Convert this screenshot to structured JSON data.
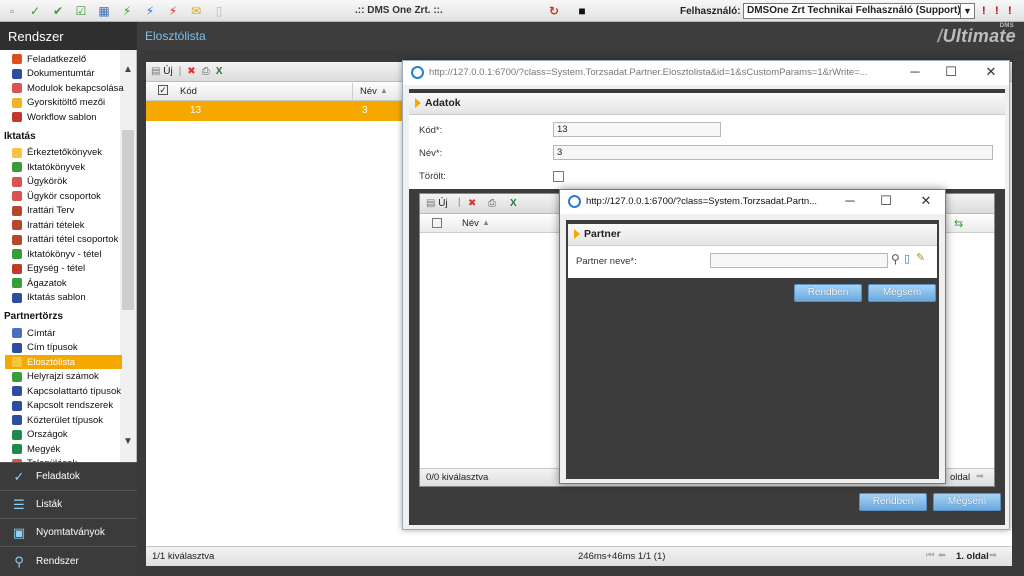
{
  "topbar": {
    "title": ".:: DMS One Zrt. ::.",
    "user_label": "Felhasználó:",
    "user_value": "DMSOne Zrt Technikai Felhasználó (Support)"
  },
  "app": {
    "left_title": "Rendszer",
    "main_title": "Elosztólista",
    "brand_small": "DMS",
    "brand": "Ultimate"
  },
  "nav": {
    "items_top": [
      {
        "label": "Feladatkezelő",
        "color": "#e04e1b"
      },
      {
        "label": "Dokumentumtár",
        "color": "#2b4f9e"
      },
      {
        "label": "Modulok bekapcsolása",
        "color": "#d9534f"
      },
      {
        "label": "Gyorskitöltő mezői",
        "color": "#f0b429"
      },
      {
        "label": "Workflow sablon",
        "color": "#c0392b"
      }
    ],
    "group_iktatas": "Iktatás",
    "items_iktatas": [
      {
        "label": "Érkeztetőkönyvek",
        "color": "#f5c542"
      },
      {
        "label": "Iktatókönyvek",
        "color": "#3a9d3a"
      },
      {
        "label": "Ügykörök",
        "color": "#d9534f"
      },
      {
        "label": "Ügykör csoportok",
        "color": "#d9534f"
      },
      {
        "label": "Irattári Terv",
        "color": "#b5472a"
      },
      {
        "label": "Irattári tételek",
        "color": "#b5472a"
      },
      {
        "label": "Irattári tétel csoportok",
        "color": "#b5472a"
      },
      {
        "label": "Iktatókönyv - tétel",
        "color": "#3a9d3a"
      },
      {
        "label": "Egység - tétel",
        "color": "#c0392b"
      },
      {
        "label": "Ágazatok",
        "color": "#3a9d3a"
      },
      {
        "label": "Iktatás sablon",
        "color": "#2b4f9e"
      }
    ],
    "group_partner": "Partnertörzs",
    "items_partner": [
      {
        "label": "Címtár",
        "color": "#4a6fc0"
      },
      {
        "label": "Cím típusok",
        "color": "#2b4f9e"
      },
      {
        "label": "Elosztólista",
        "color": "#f5c542",
        "active": true
      },
      {
        "label": "Helyrajzi számok",
        "color": "#3a9d3a"
      },
      {
        "label": "Kapcsolattartó típusok",
        "color": "#2b4f9e"
      },
      {
        "label": "Kapcsolt rendszerek",
        "color": "#2b4f9e"
      },
      {
        "label": "Közterület típusok",
        "color": "#2b4f9e"
      },
      {
        "label": "Országok",
        "color": "#1f8a4c"
      },
      {
        "label": "Megyék",
        "color": "#1f8a4c"
      },
      {
        "label": "Települések",
        "color": "#d9534f"
      }
    ]
  },
  "menu": {
    "feladatok": "Feladatok",
    "listak": "Listák",
    "nyomtatvanyok": "Nyomtatványok",
    "rendszer": "Rendszer"
  },
  "list": {
    "new_label": "Új",
    "col_kod": "Kód",
    "col_nev": "Név",
    "row": {
      "kod": "13",
      "nev": "3"
    },
    "status_left": "1/1 kiválasztva",
    "status_center": "246ms+46ms 1/1 (1)",
    "status_page": "1. oldal"
  },
  "win1": {
    "url": "http://127.0.0.1:6700/?class=System.Torzsadat.Partner.Elosztolista&id=1&sCustomParams=1&rWrite=...",
    "section": "Adatok",
    "kod_label": "Kód*:",
    "kod_value": "13",
    "nev_label": "Név*:",
    "nev_value": "3",
    "torolt_label": "Törölt:",
    "inner_new": "Új",
    "inner_col_nev": "Név",
    "inner_status": "0/0 kiválasztva",
    "inner_page": "oldal",
    "ok": "Rendben",
    "cancel": "Mégsem"
  },
  "win2": {
    "url": "http://127.0.0.1:6700/?class=System.Torzsadat.Partn...",
    "section": "Partner",
    "partner_label": "Partner neve*:",
    "partner_value": "",
    "ok": "Rendben",
    "cancel": "Mégsem"
  }
}
